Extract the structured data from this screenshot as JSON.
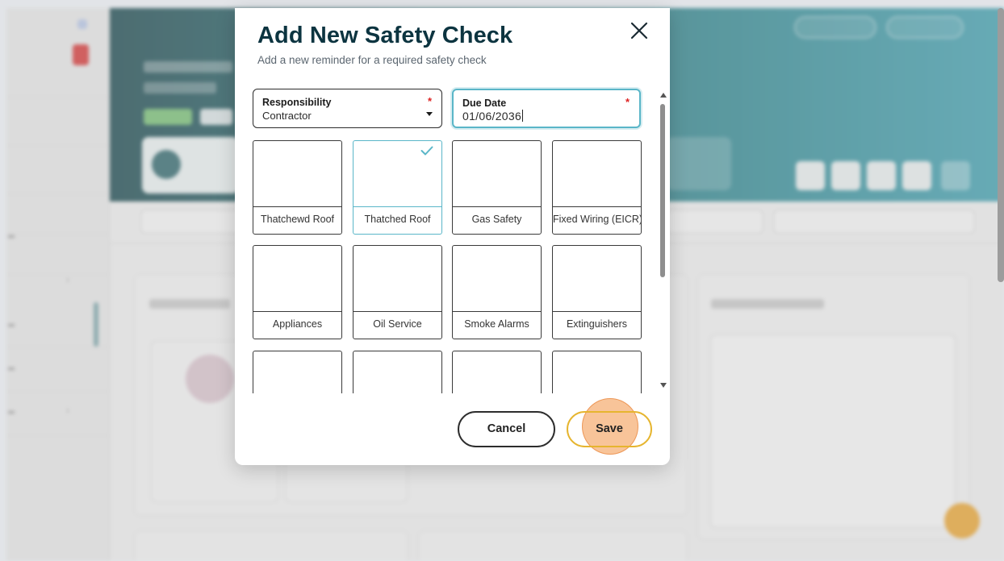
{
  "modal": {
    "title": "Add New Safety Check",
    "subtitle": "Add a new reminder for a required safety check",
    "responsibility": {
      "label": "Responsibility",
      "value": "Contractor",
      "required_mark": "*"
    },
    "due_date": {
      "label": "Due Date",
      "value": "01/06/2036",
      "required_mark": "*"
    },
    "check_types": [
      {
        "label": "Thatchewd Roof",
        "selected": false
      },
      {
        "label": "Thatched Roof",
        "selected": true
      },
      {
        "label": "Gas Safety",
        "selected": false
      },
      {
        "label": "Fixed Wiring (EICR)",
        "selected": false
      },
      {
        "label": "Appliances",
        "selected": false
      },
      {
        "label": "Oil Service",
        "selected": false
      },
      {
        "label": "Smoke Alarms",
        "selected": false
      },
      {
        "label": "Extinguishers",
        "selected": false
      },
      {
        "label": "",
        "selected": false
      },
      {
        "label": "",
        "selected": false
      },
      {
        "label": "",
        "selected": false
      },
      {
        "label": "",
        "selected": false
      }
    ],
    "cancel_label": "Cancel",
    "save_label": "Save"
  },
  "icons": {
    "close": "close-icon",
    "check": "check-icon",
    "dropdown": "chevron-down-icon"
  },
  "colors": {
    "title": "#0c3440",
    "selected_accent": "#5ab6c8",
    "save_border": "#e6b52f",
    "required": "#dd2222",
    "hero_start": "#265157",
    "hero_end": "#4aa4b3"
  }
}
